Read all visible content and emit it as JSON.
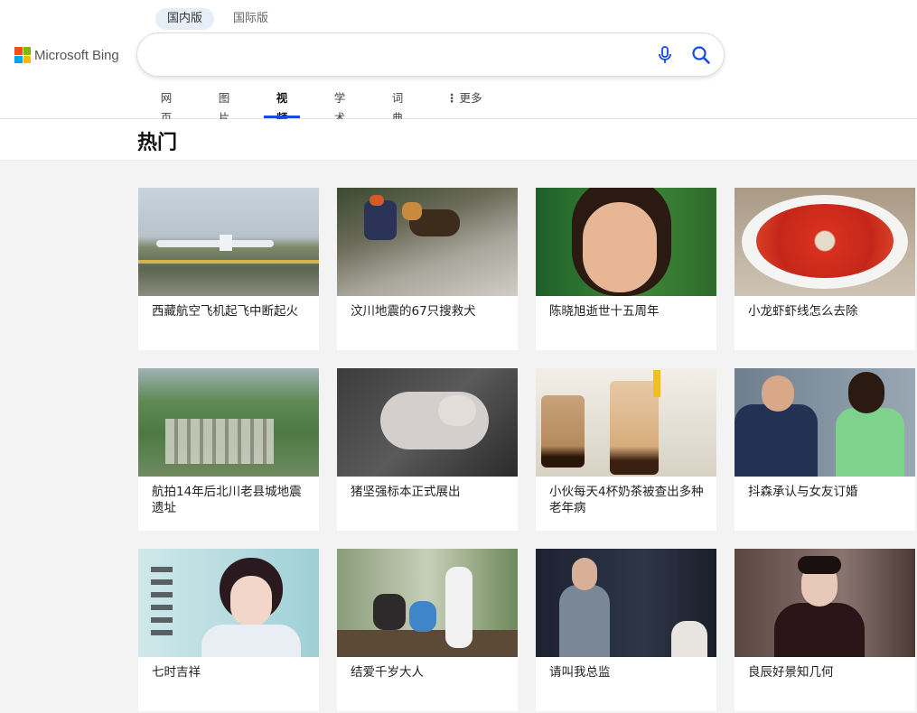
{
  "region_tabs": [
    {
      "label": "国内版",
      "active": true
    },
    {
      "label": "国际版",
      "active": false
    }
  ],
  "logo": {
    "text": "Microsoft Bing"
  },
  "search": {
    "value": "",
    "placeholder": ""
  },
  "nav": [
    {
      "label": "网页"
    },
    {
      "label": "图片"
    },
    {
      "label": "视频",
      "active": true
    },
    {
      "label": "学术"
    },
    {
      "label": "词典"
    },
    {
      "label": "更多"
    }
  ],
  "section": {
    "title": "热门"
  },
  "colors": {
    "accent": "#174ae4",
    "ms_red": "#f25022",
    "ms_green": "#7fba00",
    "ms_blue": "#00a4ef",
    "ms_yellow": "#ffb900"
  },
  "videos": [
    {
      "title": "西藏航空飞机起飞中断起火"
    },
    {
      "title": "汶川地震的67只搜救犬"
    },
    {
      "title": "陈晓旭逝世十五周年"
    },
    {
      "title": "小龙虾虾线怎么去除"
    },
    {
      "title": "航拍14年后北川老县城地震遗址"
    },
    {
      "title": "猪坚强标本正式展出"
    },
    {
      "title": "小伙每天4杯奶茶被查出多种老年病"
    },
    {
      "title": "抖森承认与女友订婚"
    },
    {
      "title": "七时吉祥"
    },
    {
      "title": "结爱千岁大人"
    },
    {
      "title": "请叫我总监"
    },
    {
      "title": "良辰好景知几何"
    }
  ]
}
